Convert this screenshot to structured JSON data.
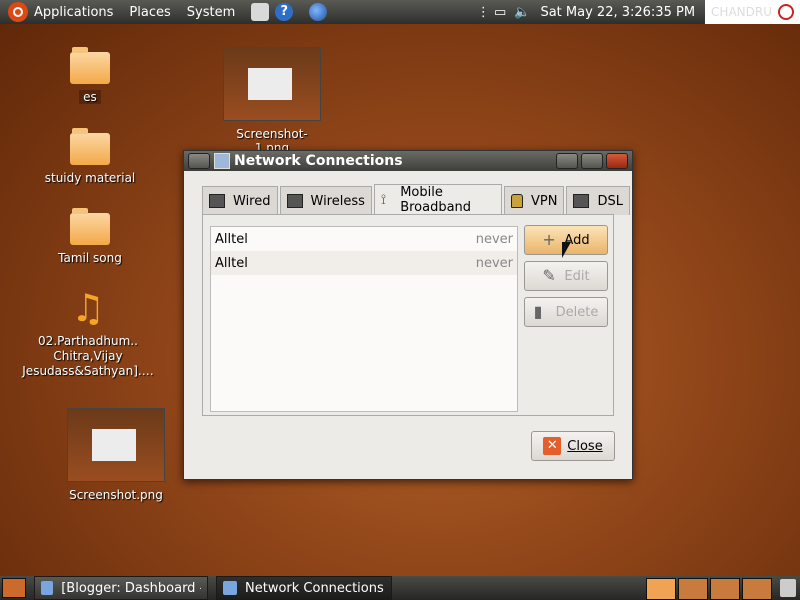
{
  "top_panel": {
    "menus": [
      "Applications",
      "Places",
      "System"
    ],
    "clock": "Sat May 22,  3:26:35 PM",
    "user": "CHANDRU"
  },
  "desktop": {
    "icons": [
      {
        "label": "es",
        "type": "folder"
      },
      {
        "label": "stuidy material",
        "type": "folder"
      },
      {
        "label": "Tamil song",
        "type": "folder"
      },
      {
        "label": "02.Parthadhum..\nChitra,Vijay\nJesudass&Sathyan].…",
        "type": "audio"
      },
      {
        "label": "Screenshot-1.png",
        "type": "image"
      },
      {
        "label": "Screenshot.png",
        "type": "image"
      }
    ]
  },
  "dialog": {
    "title": "Network Connections",
    "tabs": [
      {
        "label": "Wired",
        "icon": "wired-icon"
      },
      {
        "label": "Wireless",
        "icon": "wireless-icon"
      },
      {
        "label": "Mobile Broadband",
        "icon": "antenna-icon",
        "active": true
      },
      {
        "label": "VPN",
        "icon": "lock-icon"
      },
      {
        "label": "DSL",
        "icon": "dsl-icon"
      }
    ],
    "connections": [
      {
        "name": "Alltel",
        "last_used": "never"
      },
      {
        "name": "Alltel",
        "last_used": "never"
      }
    ],
    "buttons": {
      "add": "Add",
      "edit": "Edit",
      "delete": "Delete",
      "close": "Close"
    }
  },
  "bottom_panel": {
    "tasks": [
      {
        "label": "[Blogger: Dashboard - …",
        "active": false
      },
      {
        "label": "Network Connections",
        "active": true
      }
    ]
  }
}
